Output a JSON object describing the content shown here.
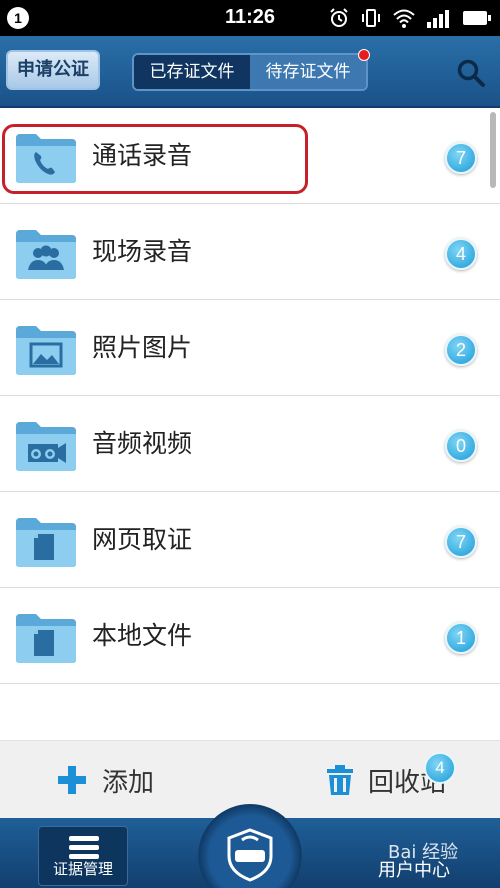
{
  "status_bar": {
    "notification_count": "1",
    "time": "11:26"
  },
  "header": {
    "apply_button": "申请公证",
    "tabs": [
      {
        "label": "已存证文件",
        "active": true
      },
      {
        "label": "待存证文件",
        "active": false,
        "has_dot": true
      }
    ],
    "search_icon": "search-icon"
  },
  "list": {
    "items": [
      {
        "label": "通话录音",
        "count": "7",
        "icon": "phone-folder-icon"
      },
      {
        "label": "现场录音",
        "count": "4",
        "icon": "people-folder-icon"
      },
      {
        "label": "照片图片",
        "count": "2",
        "icon": "image-folder-icon"
      },
      {
        "label": "音频视频",
        "count": "0",
        "icon": "camera-folder-icon"
      },
      {
        "label": "网页取证",
        "count": "7",
        "icon": "page-folder-icon"
      },
      {
        "label": "本地文件",
        "count": "1",
        "icon": "file-folder-icon"
      }
    ]
  },
  "actions": {
    "add_label": "添加",
    "recycle_label": "回收站",
    "recycle_count": "4"
  },
  "tabbar": {
    "evidence_label": "证据管理",
    "user_label": "用户中心",
    "watermark": "Bai 经验"
  },
  "colors": {
    "header": "#1f5f98",
    "badge": "#1b9bd8",
    "highlight": "#c8202a"
  }
}
